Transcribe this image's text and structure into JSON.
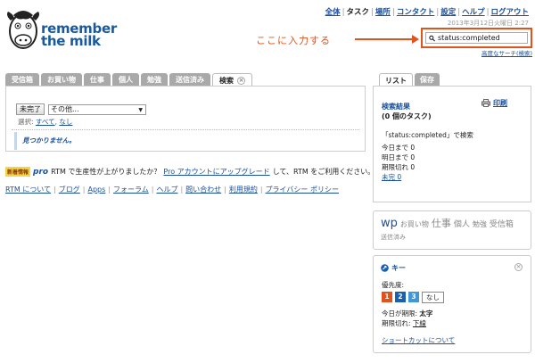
{
  "colors": {
    "accent": "#1a4f9c",
    "highlight": "#e0531b",
    "priority_1": "#e0531b",
    "priority_2": "#1a5fb4",
    "priority_3": "#3f97d8"
  },
  "logo": {
    "line1": "remember",
    "line2": "the milk"
  },
  "topnav": {
    "items": [
      "全体",
      "タスク",
      "場所",
      "コンタクト",
      "設定",
      "ヘルプ",
      "ログアウト"
    ],
    "current_index": 1,
    "timestamp": "2013年3月12日火曜日 2:27"
  },
  "annotation": {
    "text": "ここに入力する"
  },
  "search": {
    "value": "status:completed",
    "advanced_label": "高度なサーチ(検索)"
  },
  "tabs": [
    {
      "label": "受信箱"
    },
    {
      "label": "お買い物"
    },
    {
      "label": "仕事"
    },
    {
      "label": "個人"
    },
    {
      "label": "勉強"
    },
    {
      "label": "送信済み"
    },
    {
      "label": "検索"
    }
  ],
  "task_panel": {
    "complete_button": "未完了",
    "more_select": "その他...",
    "select_prefix": "選択:",
    "select_all": "すべて",
    "select_none": "なし",
    "empty_message": "見つかりません。"
  },
  "promo": {
    "badge": "新着情報",
    "pro": "pro",
    "text_before": "RTM で生産性が上がりましたか？",
    "link": "Pro アカウントにアップグレード",
    "text_after": "して、RTM をご利用ください。"
  },
  "footer": {
    "links": [
      "RTM について",
      "ブログ",
      "Apps",
      "フォーラム",
      "ヘルプ",
      "問い合わせ",
      "利用規約",
      "プライバシー ポリシー"
    ]
  },
  "right_tabs": [
    {
      "label": "リスト"
    },
    {
      "label": "保存"
    }
  ],
  "result_panel": {
    "title": "検索結果",
    "count": "(0 個のタスク)",
    "print": "印刷",
    "query": "「status:completed」で検索",
    "stats": [
      {
        "label": "今日まで",
        "value": "0"
      },
      {
        "label": "明日まで",
        "value": "0"
      },
      {
        "label": "期限切れ",
        "value": "0"
      }
    ],
    "uncompleted_label": "未完",
    "uncompleted_value": "0"
  },
  "tag_cloud": {
    "tags": [
      {
        "text": "wp",
        "size": "13px",
        "color": "#1a4f9c"
      },
      {
        "text": "お買い物",
        "size": "8px",
        "color": "#888888"
      },
      {
        "text": "仕事",
        "size": "11px",
        "color": "#888888"
      },
      {
        "text": "個人",
        "size": "9px",
        "color": "#888888"
      },
      {
        "text": "勉強",
        "size": "8px",
        "color": "#888888"
      },
      {
        "text": "受信箱",
        "size": "9px",
        "color": "#888888"
      },
      {
        "text": "送信済み",
        "size": "7px",
        "color": "#888888"
      }
    ]
  },
  "key_panel": {
    "title": "キー",
    "priority_label": "優先度:",
    "priorities": [
      "1",
      "2",
      "3"
    ],
    "priority_none": "なし",
    "due_today_label": "今日が期限:",
    "due_today_value": "太字",
    "overdue_label": "期限切れ:",
    "overdue_value": "下線",
    "shortcut_link": "ショートカットについて"
  }
}
